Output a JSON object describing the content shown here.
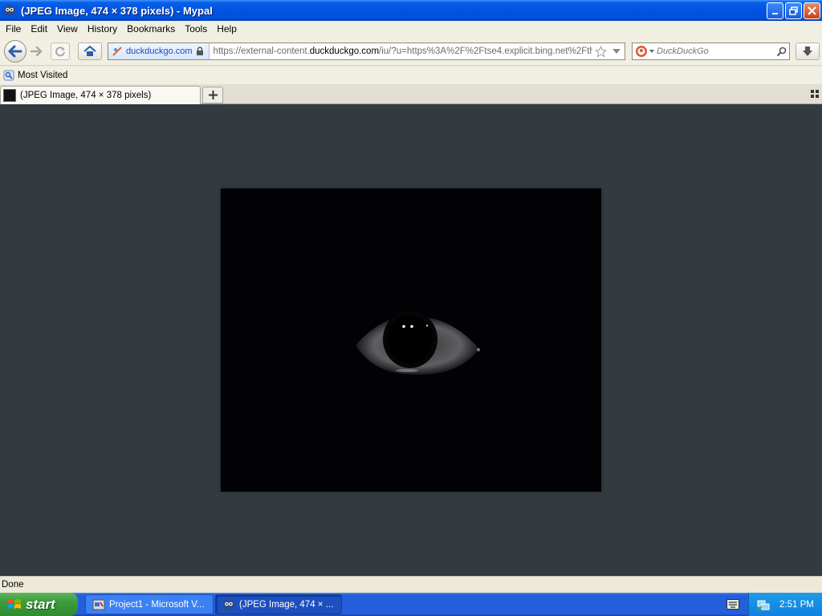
{
  "window": {
    "title": "(JPEG Image, 474 × 378 pixels) - Mypal"
  },
  "menu": [
    "File",
    "Edit",
    "View",
    "History",
    "Bookmarks",
    "Tools",
    "Help"
  ],
  "navbar": {
    "identity_domain": "duckduckgo.com",
    "url_prefix": "https://external-content.",
    "url_domain": "duckduckgo.com",
    "url_suffix": "/iu/?u=https%3A%2F%2Ftse4.explicit.bing.net%2Fth",
    "search_placeholder": "DuckDuckGo"
  },
  "bookmarks": {
    "most_visited": "Most Visited"
  },
  "tabs": [
    {
      "label": "(JPEG Image, 474 × 378 pixels)"
    }
  ],
  "content": {
    "image_description_icon": "dark-eye-image"
  },
  "status": {
    "text": "Done"
  },
  "taskbar": {
    "start_label": "start",
    "tasks": [
      {
        "label": "Project1 - Microsoft V..."
      },
      {
        "label": "(JPEG Image, 474 × ..."
      }
    ],
    "clock": "2:51 PM"
  },
  "colors": {
    "titlebar": "#0054E3",
    "content_bg": "#333B41",
    "image_bg": "#020104",
    "start_green": "#3D9C3C",
    "taskbar_blue": "#245EDB"
  }
}
